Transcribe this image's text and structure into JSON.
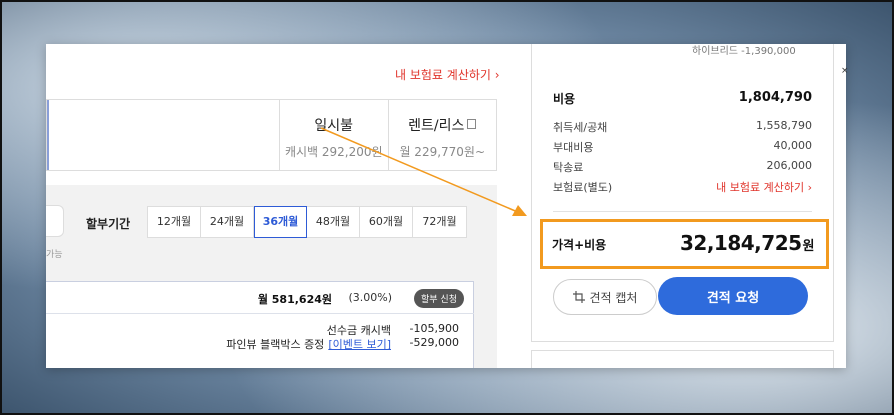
{
  "header": {
    "calc_link": "내 보험료 계산하기 ›"
  },
  "payment_tabs": [
    {
      "title": "",
      "sub": ""
    },
    {
      "title": "일시불",
      "sub": "캐시백 292,200원"
    },
    {
      "title": "렌트/리스",
      "sub": "월 229,770원~"
    }
  ],
  "installment": {
    "stub_text": "가능",
    "label": "할부기간",
    "terms": [
      "12개월",
      "24개월",
      "36개월",
      "48개월",
      "60개월",
      "72개월"
    ],
    "active_term": "36개월",
    "monthly_amount": "월 581,624원",
    "rate": "(3.00%)",
    "apply_button": "할부 신청",
    "bonus": [
      {
        "label": "선수금 캐시백",
        "link": "",
        "value": "-105,900"
      },
      {
        "label": "파인뷰 블랙박스 증정",
        "link": "[이벤트 보기]",
        "value": "-529,000"
      }
    ]
  },
  "costs": {
    "hybrid_text": "하이브리드  -1,390,000",
    "title": "비용",
    "total": "1,804,790",
    "rows": [
      {
        "label": "취득세/공채",
        "value": "1,558,790"
      },
      {
        "label": "부대비용",
        "value": "40,000"
      },
      {
        "label": "탁송료",
        "value": "206,000"
      },
      {
        "label": "보험료(별도)",
        "value": "내 보험료 계산하기 ›"
      }
    ],
    "sum_label": "가격+비용",
    "sum_value": "32,184,725",
    "sum_unit": "원",
    "capture_button": "견적 캡처",
    "request_button": "견적 요청"
  },
  "colors": {
    "accent_blue": "#2e6bdc",
    "highlight_orange": "#f29a1f",
    "link_red": "#e0342b"
  }
}
